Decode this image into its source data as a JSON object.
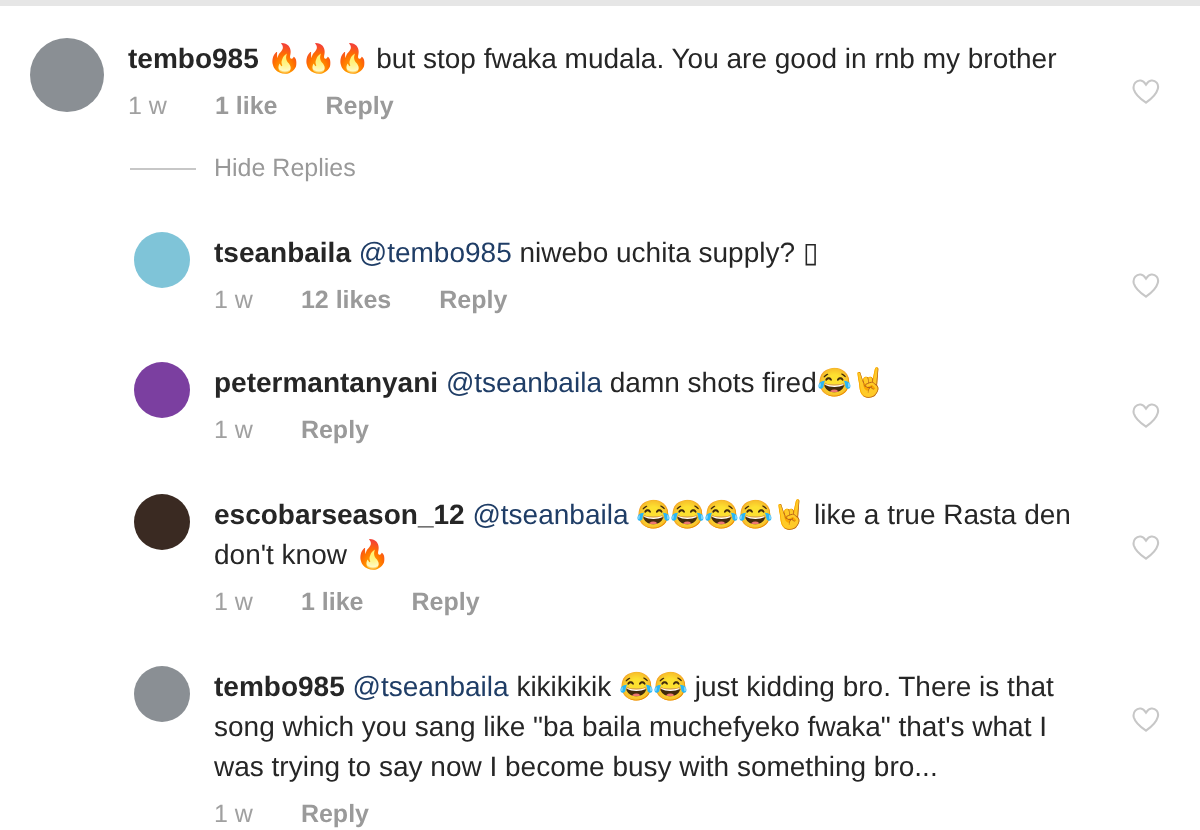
{
  "comment": {
    "username": "tembo985",
    "text": "🔥🔥🔥 but stop  fwaka mudala.  You are  good  in rnb my brother",
    "time": "1 w",
    "likes": "1 like",
    "reply": "Reply",
    "liked": false
  },
  "hide_replies": "Hide Replies",
  "replies": [
    {
      "username": "tseanbaila",
      "mention": "@tembo985",
      "text": "niwebo uchita supply? ▯",
      "time": "1 w",
      "likes": "12 likes",
      "reply": "Reply",
      "liked": false
    },
    {
      "username": "petermantanyani",
      "mention": "@tseanbaila",
      "text": "damn shots fired😂🤘",
      "time": "1 w",
      "reply": "Reply",
      "liked": false
    },
    {
      "username": "escobarseason_12",
      "mention": "@tseanbaila",
      "text": "😂😂😂😂🤘 like a true Rasta den don't know 🔥",
      "time": "1 w",
      "likes": "1 like",
      "reply": "Reply",
      "liked": false
    },
    {
      "username": "tembo985",
      "mention": "@tseanbaila",
      "text": "kikikikik 😂😂 just kidding bro. There is that song which you  sang like \"ba baila muchefyeko fwaka\" that's  what I was trying to say now I become busy with something bro...",
      "time": "1 w",
      "reply": "Reply",
      "liked": false
    }
  ]
}
